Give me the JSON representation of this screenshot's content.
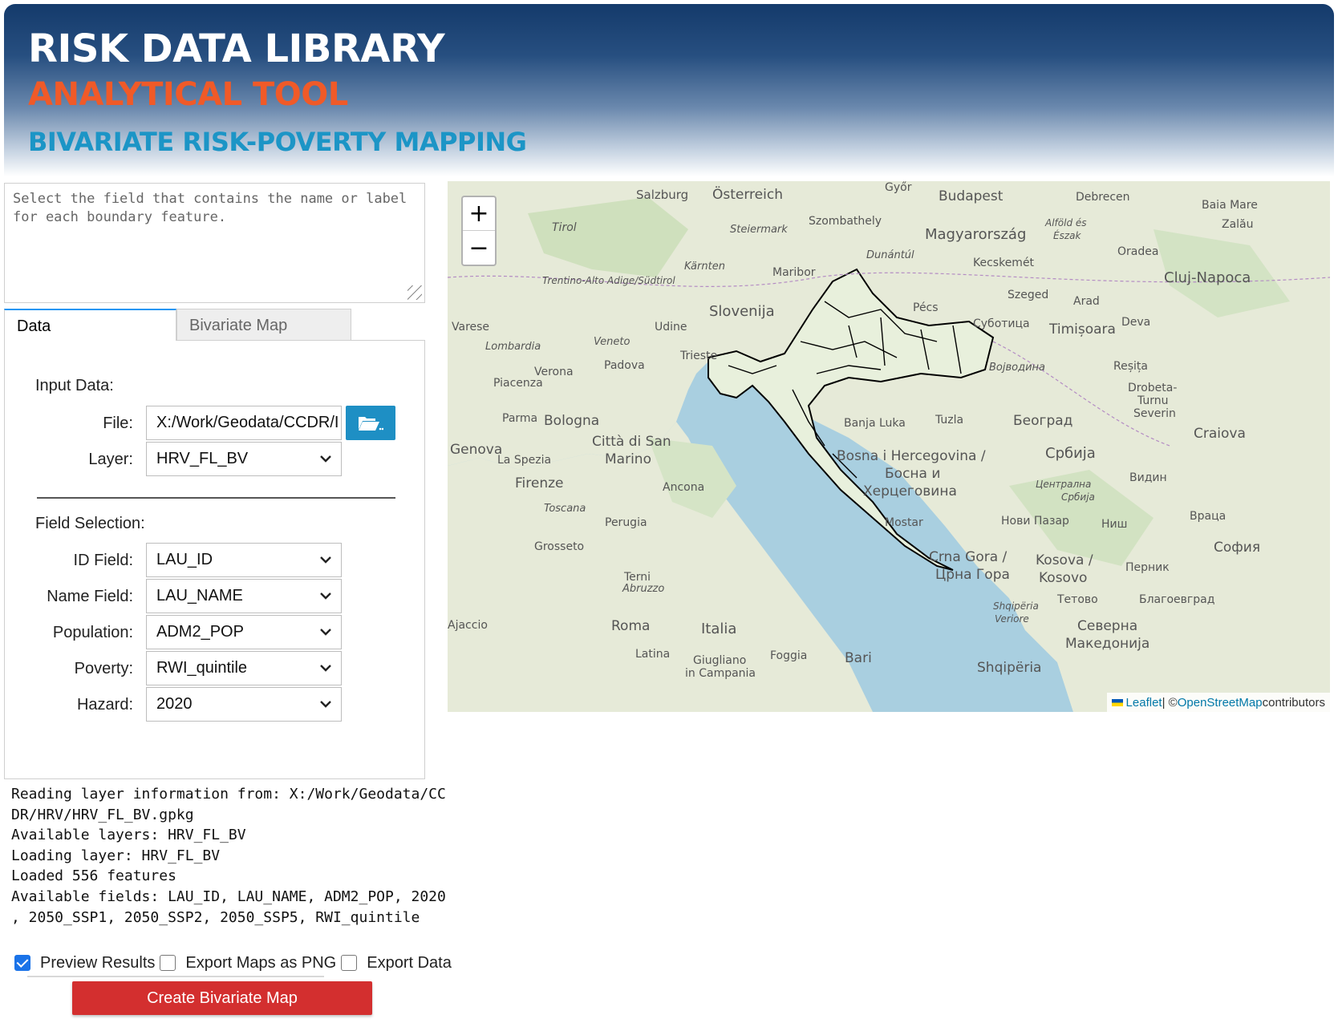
{
  "header": {
    "title": "RISK DATA LIBRARY",
    "subtitle": "ANALYTICAL TOOL",
    "section": "BIVARIATE RISK-POVERTY MAPPING"
  },
  "description": "Select the field that contains the name or label for each boundary feature.",
  "tabs": [
    {
      "label": "Data",
      "active": true
    },
    {
      "label": "Bivariate Map",
      "active": false
    }
  ],
  "input_data": {
    "heading": "Input Data:",
    "file_label": "File:",
    "file_value": "X:/Work/Geodata/CCDR/HRV/HRV_FL_BV.gpkg",
    "file_value_visible": "X:/Work/Geodata/CCDR/I",
    "layer_label": "Layer:",
    "layer_value": "HRV_FL_BV"
  },
  "field_selection": {
    "heading": "Field Selection:",
    "fields": [
      {
        "label": "ID Field:",
        "value": "LAU_ID"
      },
      {
        "label": "Name Field:",
        "value": "LAU_NAME"
      },
      {
        "label": "Population:",
        "value": "ADM2_POP"
      },
      {
        "label": "Poverty:",
        "value": "RWI_quintile"
      },
      {
        "label": "Hazard:",
        "value": "2020"
      }
    ]
  },
  "log": [
    "Reading layer information from: X:/Work/Geodata/CC",
    "DR/HRV/HRV_FL_BV.gpkg",
    "Available layers: HRV_FL_BV",
    "Loading layer: HRV_FL_BV",
    "Loaded 556 features",
    "Available fields: LAU_ID, LAU_NAME, ADM2_POP, 2020",
    ", 2050_SSP1, 2050_SSP2, 2050_SSP5, RWI_quintile"
  ],
  "options": [
    {
      "label": "Preview Results",
      "checked": true
    },
    {
      "label": "Export Maps as PNG",
      "checked": false
    },
    {
      "label": "Export Data",
      "checked": false
    }
  ],
  "create_button": "Create Bivariate Map",
  "map": {
    "zoom_in": "+",
    "zoom_out": "−",
    "attribution": {
      "leaflet": "Leaflet",
      "sep": " | © ",
      "osm": "OpenStreetMap",
      "suffix": " contributors"
    },
    "labels": [
      "Salzburg",
      "Österreich",
      "Győr",
      "Budapest",
      "Debrecen",
      "Baia Mare",
      "Zalău",
      "Tirol",
      "Steiermark",
      "Szombathely",
      "Magyarország",
      "Alföld és Észak",
      "Oradea",
      "Kärnten",
      "Maribor",
      "Dunántúl",
      "Kecskemét",
      "Cluj-Napoca",
      "Trentino-Alto Adige/Südtirol",
      "Szeged",
      "Arad",
      "Slovenija",
      "Pécs",
      "Суботица",
      "Timișoara",
      "Deva",
      "Varese",
      "Udine",
      "Veneto",
      "Lombardia",
      "Padova",
      "Trieste",
      "Verona",
      "Војводина",
      "Reșița",
      "Piacenza",
      "Drobeta-Turnu Severin",
      "Parma",
      "Bologna",
      "Banja Luka",
      "Tuzla",
      "Београд",
      "Craiova",
      "Genova",
      "La Spezia",
      "Città di San Marino",
      "Bosna i Hercegovina / Босна и Херцеговина",
      "Србија",
      "Видин",
      "Firenze",
      "Ancona",
      "Централна Србија",
      "Toscana",
      "Perugia",
      "Mostar",
      "Нови Пазар",
      "Ниш",
      "Враца",
      "Grosseto",
      "Crna Gora / Црна Гора",
      "Kosova / Kosovo",
      "София",
      "Перник",
      "Abruzzo",
      "Terni",
      "Тетово",
      "Благоевград",
      "Shqipëria Veriore",
      "Ajaccio",
      "Roma",
      "Italia",
      "Северна Македонија",
      "Latina",
      "Foggia",
      "Giugliano in Campania",
      "Bari",
      "Shqipëria"
    ]
  }
}
